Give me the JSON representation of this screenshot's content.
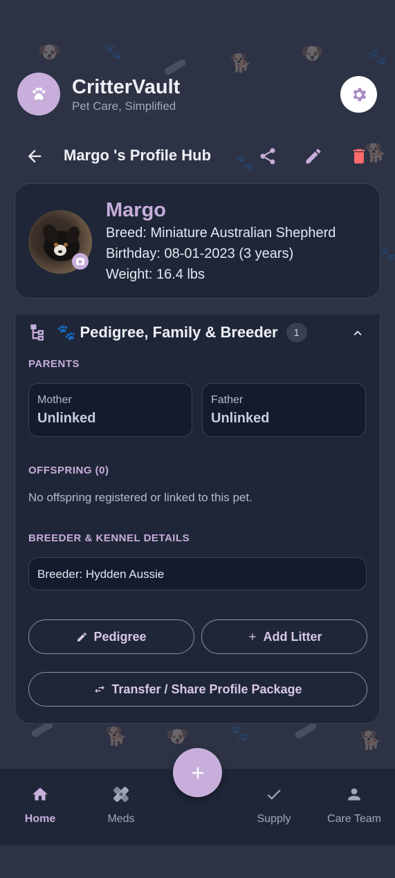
{
  "app": {
    "title": "CritterVault",
    "subtitle": "Pet Care, Simplified"
  },
  "nav": {
    "hub_title": "Margo 's Profile Hub"
  },
  "profile": {
    "name": "Margo",
    "breed": "Breed: Miniature Australian Shepherd",
    "birthday": "Birthday: 08-01-2023 (3 years)",
    "weight": "Weight: 16.4 lbs"
  },
  "pedigree": {
    "title": "🐾 Pedigree, Family & Breeder",
    "count": "1",
    "parents_label": "PARENTS",
    "mother": {
      "label": "Mother",
      "value": "Unlinked"
    },
    "father": {
      "label": "Father",
      "value": "Unlinked"
    },
    "offspring_label": "OFFSPRING (0)",
    "offspring_empty": "No offspring registered or linked to this pet.",
    "breeder_label": "BREEDER & KENNEL DETAILS",
    "breeder_value": "Breeder: Hydden Aussie",
    "pedigree_button": "Pedigree",
    "add_litter_button": "Add Litter",
    "transfer_button": "Transfer / Share Profile Package"
  },
  "bottom_nav": [
    {
      "label": "Home",
      "icon": "home-icon"
    },
    {
      "label": "Meds",
      "icon": "bandage-icon"
    },
    {
      "label": "Supply",
      "icon": "check-icon"
    },
    {
      "label": "Care Team",
      "icon": "person-icon"
    }
  ],
  "colors": {
    "accent": "#c7aedb",
    "background": "#2d3344",
    "card": "#1f2638",
    "danger": "#ff6b6b"
  }
}
